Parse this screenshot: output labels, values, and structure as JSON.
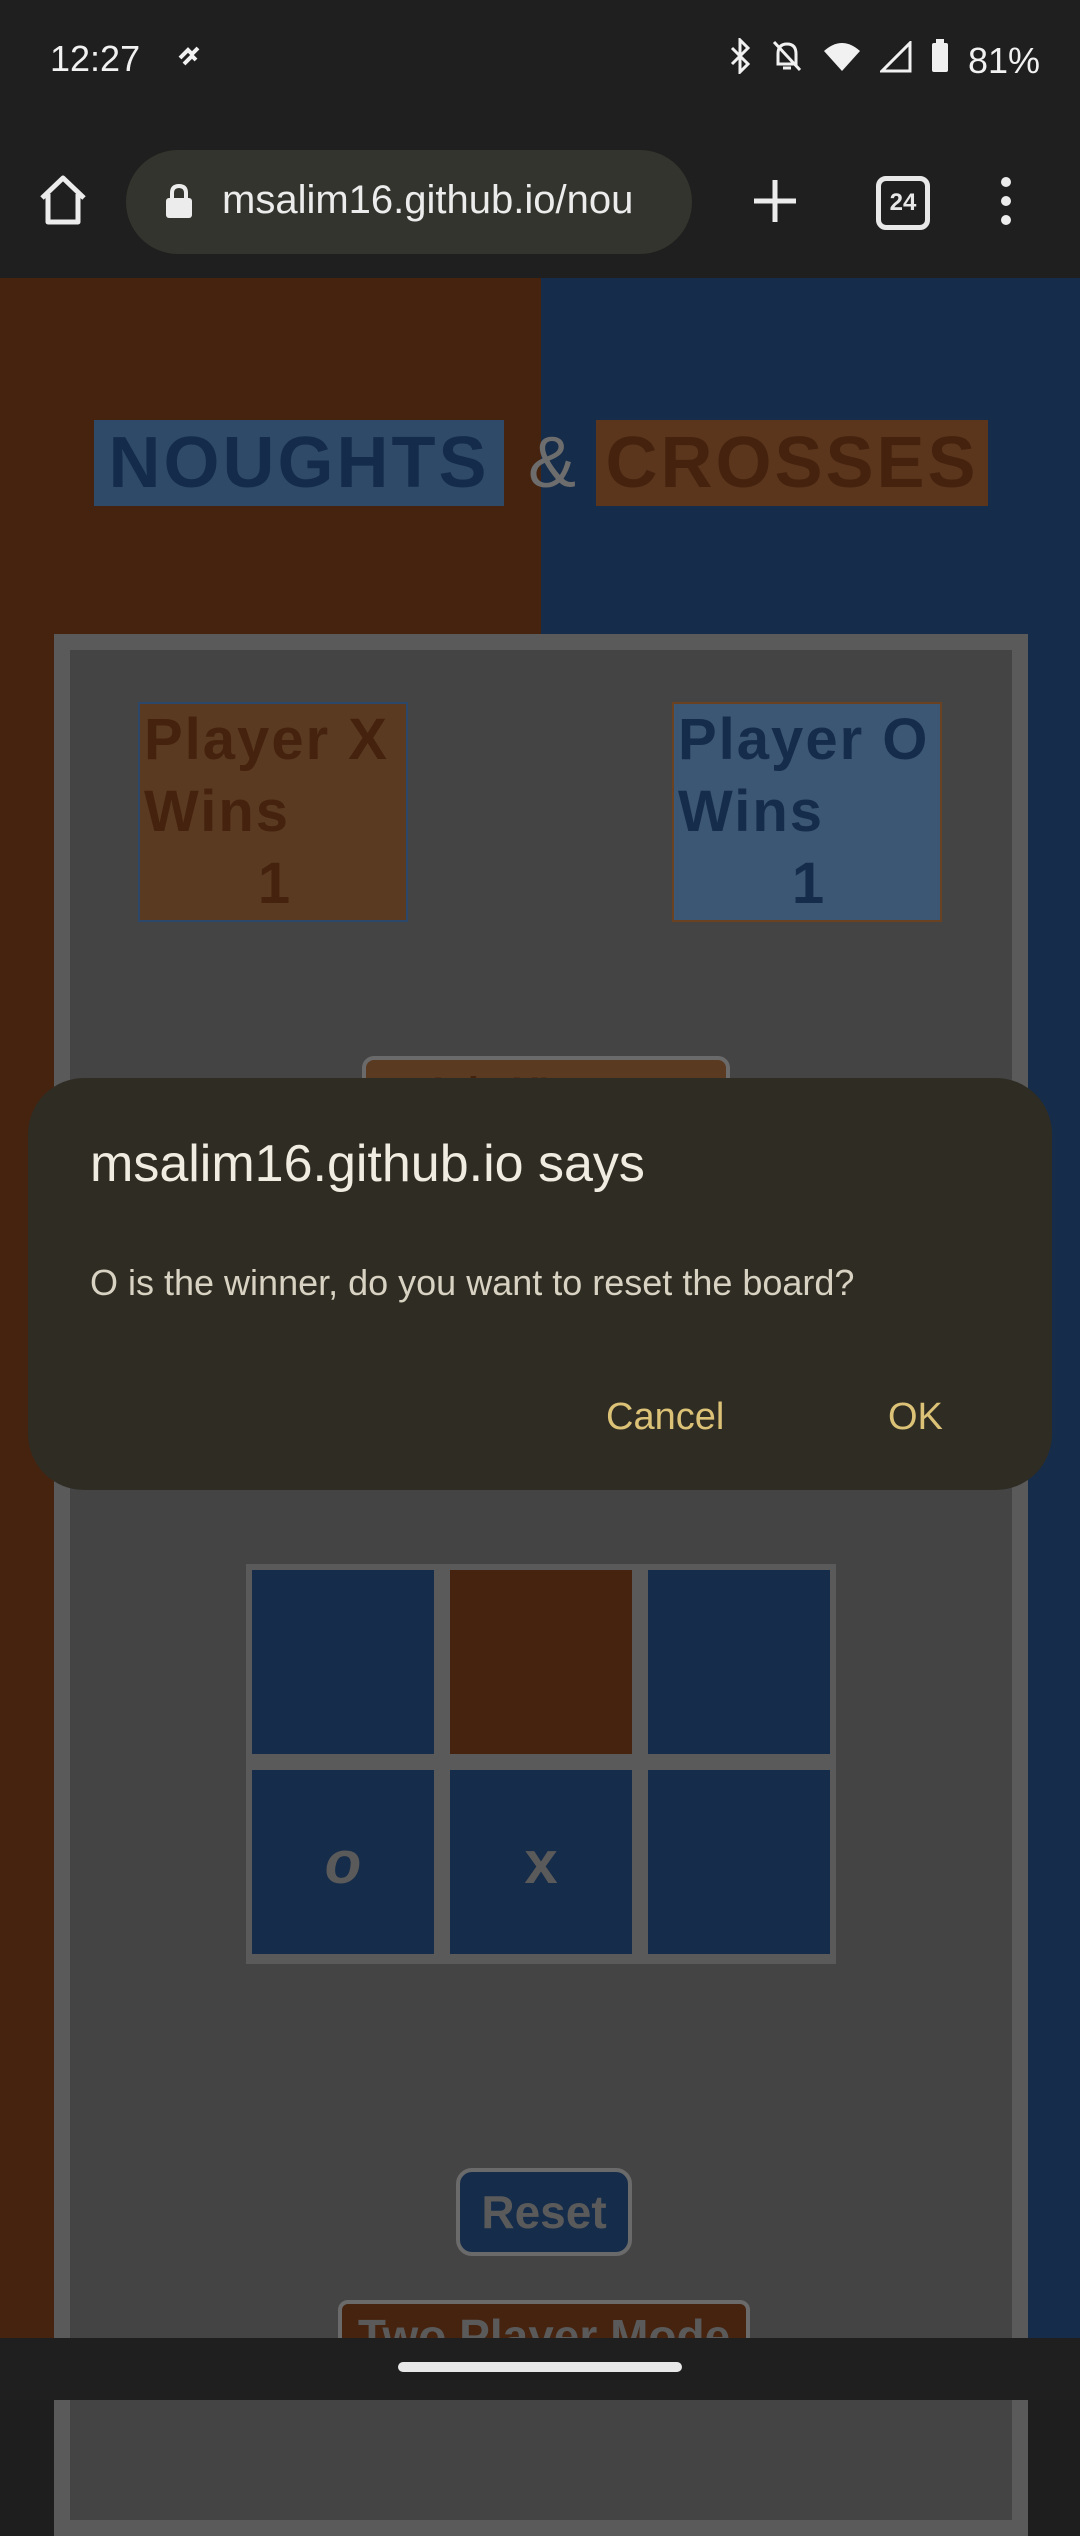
{
  "status_bar": {
    "time": "12:27",
    "battery": "81%"
  },
  "browser": {
    "url": "msalim16.github.io/nou",
    "tab_count": "24"
  },
  "page": {
    "title_left": "NOUGHTS",
    "title_amp": "&",
    "title_right": "CROSSES",
    "score_x_label": "Player X Wins",
    "score_x_value": "1",
    "score_o_label": "Player O Wins",
    "score_o_value": "1",
    "turn_button_partial": "It is X's turn",
    "board": {
      "row3": [
        "o",
        "x",
        ""
      ]
    },
    "reset_label": "Reset",
    "two_player_label": "Two Player Mode"
  },
  "dialog": {
    "title": "msalim16.github.io says",
    "message": "O is the winner, do you want to reset the board?",
    "cancel_label": "Cancel",
    "ok_label": "OK"
  },
  "colors": {
    "brown": "#45230f",
    "navy": "#152c4a",
    "dialog_bg": "#2f2c23",
    "dialog_accent": "#dcc277"
  }
}
